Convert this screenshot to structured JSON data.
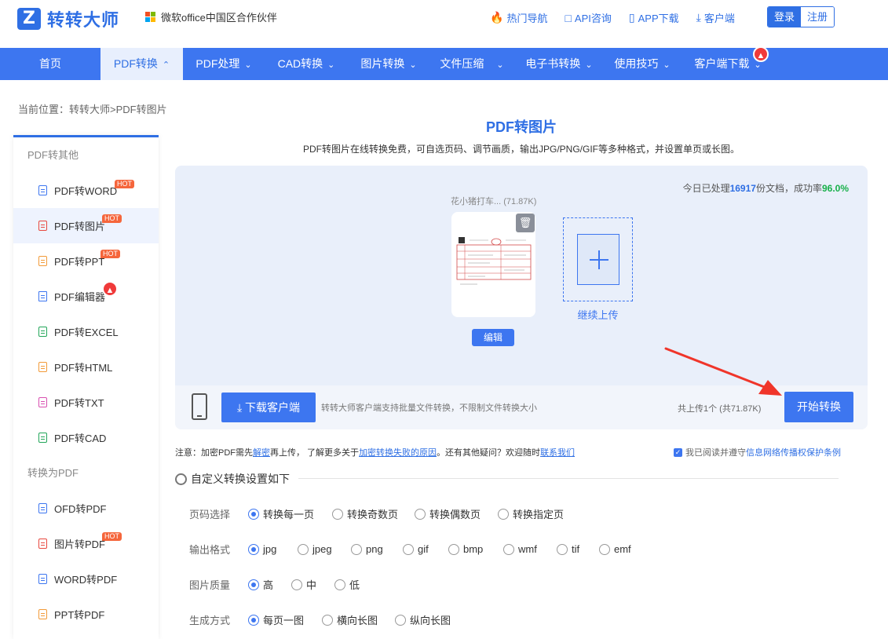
{
  "header": {
    "logo_mark": "Z",
    "logo_text": "转转大师",
    "partner": "微软office中国区合作伙伴",
    "links": [
      {
        "icon": "flame-icon",
        "label": "热门导航"
      },
      {
        "icon": "chat-icon",
        "label": "API咨询"
      },
      {
        "icon": "phone-icon",
        "label": "APP下载"
      },
      {
        "icon": "download-icon",
        "label": "客户端"
      }
    ],
    "login": "登录",
    "register": "注册"
  },
  "nav": {
    "items": [
      "首页",
      "PDF转换",
      "PDF处理",
      "CAD转换",
      "图片转换",
      "文件压缩",
      "电子书转换",
      "使用技巧",
      "客户端下载"
    ],
    "active_index": 1
  },
  "breadcrumb": "当前位置：转转大师>PDF转图片",
  "sidebar": {
    "group1": "PDF转其他",
    "items1": [
      {
        "label": "PDF转WORD",
        "badge": "HOT",
        "color": "#3d76f0"
      },
      {
        "label": "PDF转图片",
        "badge": "HOT",
        "color": "#e8483f"
      },
      {
        "label": "PDF转PPT",
        "badge": "HOT",
        "color": "#f29a38"
      },
      {
        "label": "PDF编辑器",
        "badge": "fire",
        "color": "#3d76f0"
      },
      {
        "label": "PDF转EXCEL",
        "badge": "",
        "color": "#22a659"
      },
      {
        "label": "PDF转HTML",
        "badge": "",
        "color": "#f29a38"
      },
      {
        "label": "PDF转TXT",
        "badge": "",
        "color": "#d84fb0"
      },
      {
        "label": "PDF转CAD",
        "badge": "",
        "color": "#22a659"
      }
    ],
    "group2": "转换为PDF",
    "items2": [
      {
        "label": "OFD转PDF",
        "badge": "",
        "color": "#3d76f0"
      },
      {
        "label": "图片转PDF",
        "badge": "HOT",
        "color": "#e8483f"
      },
      {
        "label": "WORD转PDF",
        "badge": "",
        "color": "#3d76f0"
      },
      {
        "label": "PPT转PDF",
        "badge": "",
        "color": "#f29a38"
      }
    ],
    "active": "PDF转图片"
  },
  "main": {
    "title": "PDF转图片",
    "subtitle": "PDF转图片在线转换免费，可自选页码、调节画质，输出JPG/PNG/GIF等多种格式，并设置单页或长图。",
    "stats_prefix": "今日已处理",
    "stats_count": "16917",
    "stats_mid": "份文档，成功率",
    "stats_rate": "96.0%",
    "file_name": "花小猪打车... (71.87K)",
    "edit": "编辑",
    "continue_upload": "继续上传",
    "download_client": "下载客户端",
    "client_tip": "转转大师客户端支持批量文件转换，不限制文件转换大小",
    "upload_info": "共上传1个 (共71.87K)",
    "start": "开始转换"
  },
  "notice": {
    "p1": "注意：加密PDF需先",
    "l1": "解密",
    "p2": "再上传， 了解更多关于",
    "l2": "加密转换失败的原因",
    "p3": "。还有其他疑问？欢迎随时",
    "l3": "联系我们",
    "agree_prefix": "我已阅读并遵守",
    "agree_link": "信息网络传播权保护条例"
  },
  "settings": {
    "header": "自定义转换设置如下",
    "rows": [
      {
        "label": "页码选择",
        "options": [
          "转换每一页",
          "转换奇数页",
          "转换偶数页",
          "转换指定页"
        ],
        "selected": 0
      },
      {
        "label": "输出格式",
        "options": [
          "jpg",
          "jpeg",
          "png",
          "gif",
          "bmp",
          "wmf",
          "tif",
          "emf"
        ],
        "selected": 0
      },
      {
        "label": "图片质量",
        "options": [
          "高",
          "中",
          "低"
        ],
        "selected": 0
      },
      {
        "label": "生成方式",
        "options": [
          "每页一图",
          "横向长图",
          "纵向长图"
        ],
        "selected": 0
      }
    ]
  }
}
